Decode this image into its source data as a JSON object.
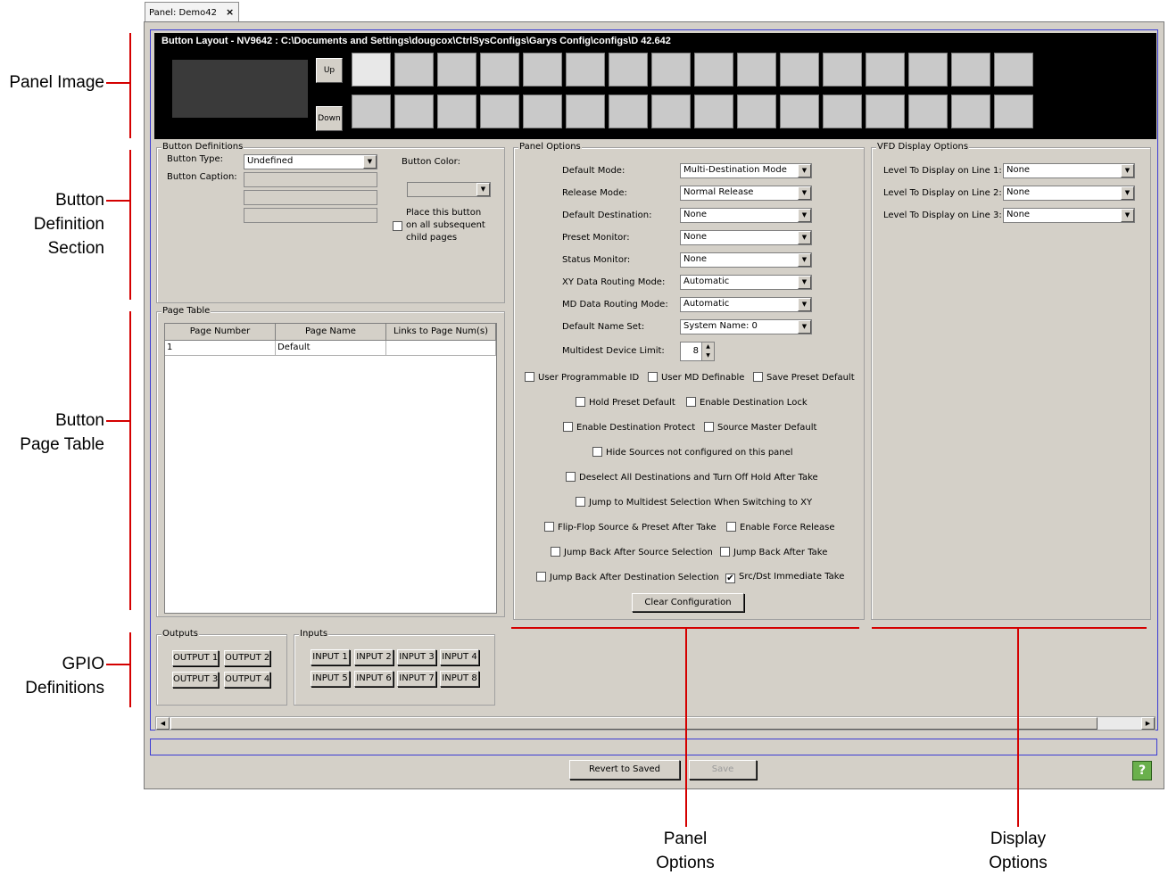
{
  "tab": {
    "label": "Panel: Demo42",
    "close": "×"
  },
  "callouts": {
    "panel_image": "Panel Image",
    "button_definition": [
      "Button",
      "Definition",
      "Section"
    ],
    "button_page_table": [
      "Button",
      "Page Table"
    ],
    "gpio": [
      "GPIO",
      "Definitions"
    ],
    "panel_options": [
      "Panel",
      "Options"
    ],
    "display_options": [
      "Display",
      "Options"
    ]
  },
  "panel_image": {
    "title": "Button Layout - NV9642 : C:\\Documents and Settings\\dougcox\\CtrlSysConfigs\\Garys Config\\configs\\D 42.642",
    "up": "Up",
    "down": "Down"
  },
  "button_definitions": {
    "title": "Button Definitions",
    "type_label": "Button Type:",
    "type_value": "Undefined",
    "caption_label": "Button Caption:",
    "color_label": "Button Color:",
    "place_label": [
      "Place this button",
      "on all subsequent",
      "child pages"
    ]
  },
  "page_table": {
    "title": "Page Table",
    "columns": [
      "Page Number",
      "Page Name",
      "Links to Page Num(s)"
    ],
    "rows": [
      [
        "1",
        "Default",
        ""
      ]
    ]
  },
  "panel_options": {
    "title": "Panel Options",
    "fields": [
      {
        "label": "Default Mode:",
        "value": "Multi-Destination Mode"
      },
      {
        "label": "Release Mode:",
        "value": "Normal Release"
      },
      {
        "label": "Default Destination:",
        "value": "None"
      },
      {
        "label": "Preset Monitor:",
        "value": "None"
      },
      {
        "label": "Status Monitor:",
        "value": "None"
      },
      {
        "label": "XY Data Routing Mode:",
        "value": "Automatic"
      },
      {
        "label": "MD Data Routing Mode:",
        "value": "Automatic"
      },
      {
        "label": "Default Name Set:",
        "value": "System Name: 0"
      }
    ],
    "limit_label": "Multidest Device Limit:",
    "limit_value": "8",
    "checks": {
      "user_prog_id": "User Programmable ID",
      "user_md": "User MD Definable",
      "save_preset": "Save Preset Default",
      "hold_preset": "Hold Preset Default",
      "dest_lock": "Enable Destination Lock",
      "dest_protect": "Enable Destination Protect",
      "source_master": "Source Master Default",
      "hide_sources": "Hide Sources not configured on this panel",
      "deselect_all": "Deselect All Destinations and Turn Off Hold After Take",
      "jump_multidest": "Jump to Multidest Selection When Switching to XY",
      "flip_flop": "Flip-Flop Source & Preset After Take",
      "force_release": "Enable Force Release",
      "jump_source": "Jump Back After Source Selection",
      "jump_take": "Jump Back After Take",
      "jump_dest": "Jump Back After Destination Selection",
      "immediate_take": "Src/Dst Immediate Take"
    },
    "checked_mark": "✔",
    "clear": "Clear Configuration"
  },
  "vfd": {
    "title": "VFD Display Options",
    "fields": [
      {
        "label": "Level To Display on Line 1:",
        "value": "None"
      },
      {
        "label": "Level To Display on Line 2:",
        "value": "None"
      },
      {
        "label": "Level To Display on Line 3:",
        "value": "None"
      }
    ]
  },
  "outputs": {
    "title": "Outputs",
    "items": [
      "OUTPUT 1",
      "OUTPUT 2",
      "OUTPUT 3",
      "OUTPUT 4"
    ]
  },
  "inputs": {
    "title": "Inputs",
    "items": [
      "INPUT 1",
      "INPUT 2",
      "INPUT 3",
      "INPUT 4",
      "INPUT 5",
      "INPUT 6",
      "INPUT 7",
      "INPUT 8"
    ]
  },
  "footer": {
    "revert": "Revert to Saved",
    "save": "Save",
    "help": "?"
  },
  "icons": {
    "dropdown": "▼",
    "left": "◀",
    "right": "▶",
    "spin_up": "▲",
    "spin_down": "▼"
  }
}
